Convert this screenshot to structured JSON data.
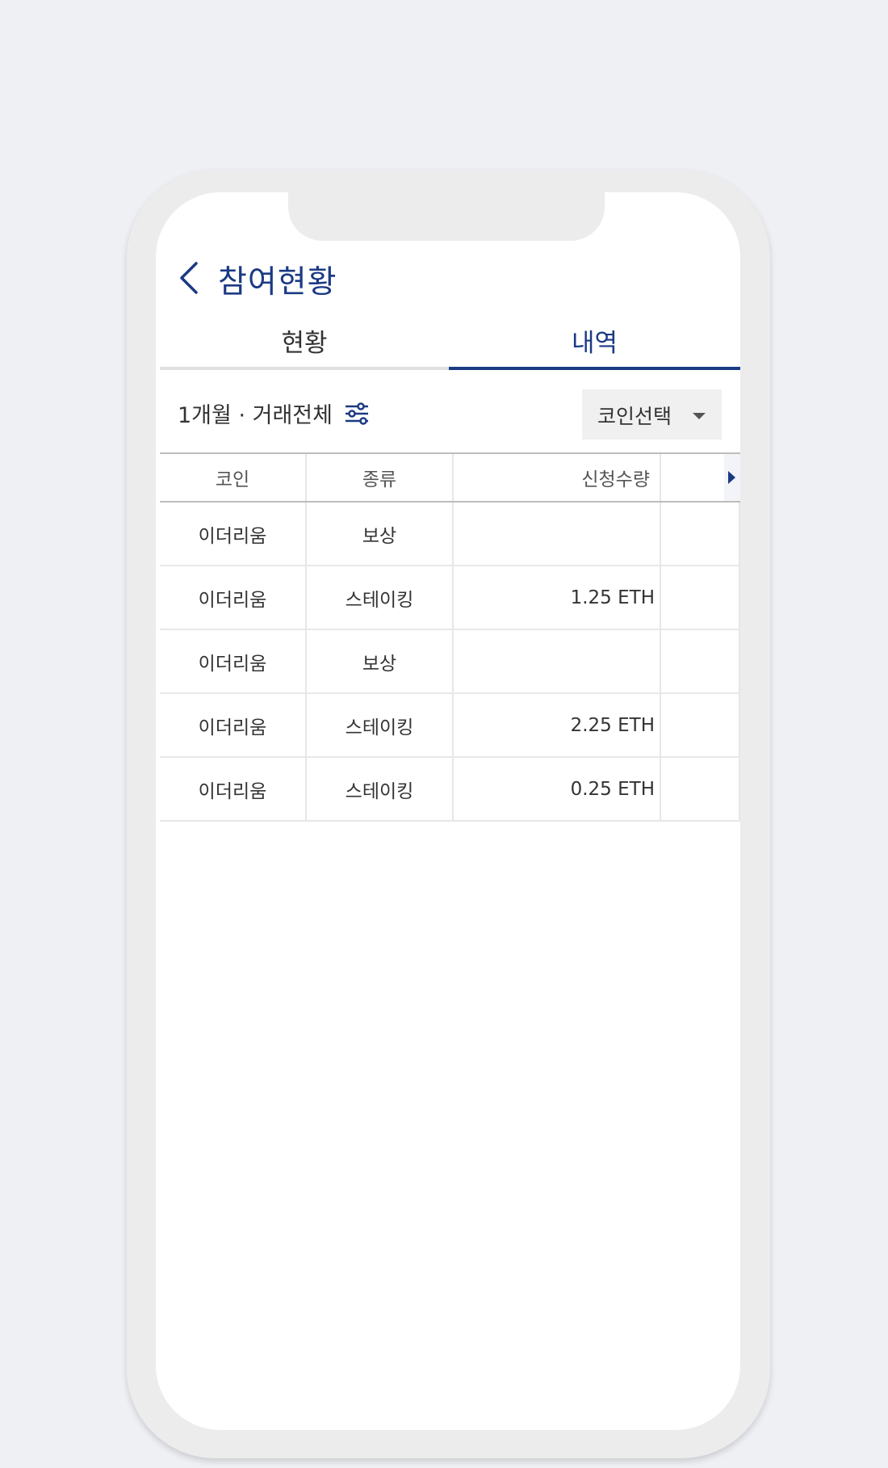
{
  "header": {
    "title": "참여현황"
  },
  "tabs": [
    {
      "label": "현황",
      "active": false
    },
    {
      "label": "내역",
      "active": true
    }
  ],
  "filter": {
    "summary": "1개월 · 거래전체",
    "coin_select_label": "코인선택"
  },
  "table": {
    "columns": [
      "코인",
      "종류",
      "신청수량",
      ""
    ],
    "rows": [
      {
        "coin": "이더리움",
        "type": "보상",
        "amount": ""
      },
      {
        "coin": "이더리움",
        "type": "스테이킹",
        "amount": "1.25 ETH"
      },
      {
        "coin": "이더리움",
        "type": "보상",
        "amount": ""
      },
      {
        "coin": "이더리움",
        "type": "스테이킹",
        "amount": "2.25 ETH"
      },
      {
        "coin": "이더리움",
        "type": "스테이킹",
        "amount": "0.25 ETH"
      }
    ]
  },
  "colors": {
    "accent": "#1b3a84",
    "background": "#eef0f4",
    "phone_frame": "#ececec"
  },
  "icons": {
    "back": "chevron-left-icon",
    "filter": "sliders-icon",
    "dropdown": "caret-down-icon",
    "scroll": "caret-right-icon"
  }
}
